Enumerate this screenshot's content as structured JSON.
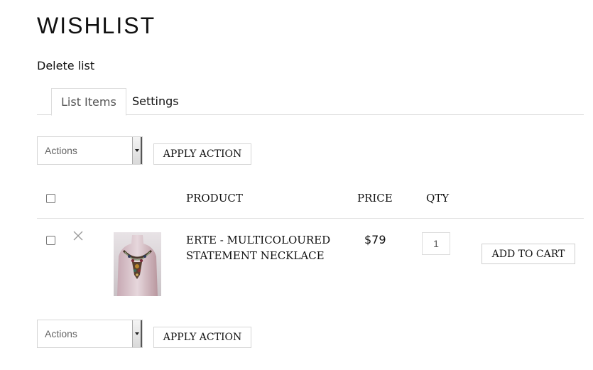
{
  "page": {
    "title": "WISHLIST",
    "delete_label": "Delete list"
  },
  "tabs": [
    {
      "label": "List Items",
      "active": true
    },
    {
      "label": "Settings",
      "active": false
    }
  ],
  "bulk_actions": {
    "top": {
      "select_value": "Actions",
      "apply_label": "APPLY ACTION"
    },
    "bottom": {
      "select_value": "Actions",
      "apply_label": "APPLY ACTION"
    }
  },
  "table": {
    "headers": {
      "product": "PRODUCT",
      "price": "PRICE",
      "qty": "QTY"
    },
    "rows": [
      {
        "product_line1": "ERTE - MULTICOLOURED",
        "product_line2": "STATEMENT NECKLACE",
        "price": "$79",
        "qty": "1",
        "add_to_cart_label": "ADD TO CART"
      }
    ]
  },
  "icons": {
    "remove": "close-icon",
    "dropdown": "chevron-down-icon"
  }
}
